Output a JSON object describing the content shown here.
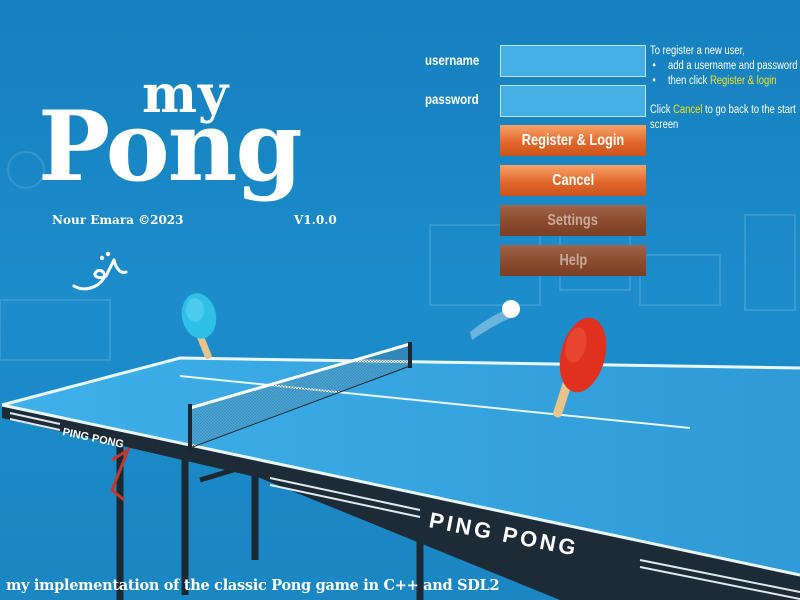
{
  "title": {
    "my": "my",
    "pong": "Pong"
  },
  "author": "Nour Emara ©2023",
  "version": "V1.0.0",
  "form": {
    "username_label": "username",
    "password_label": "password",
    "username_value": "",
    "password_value": ""
  },
  "buttons": {
    "register": "Register & Login",
    "cancel": "Cancel",
    "settings": "Settings",
    "help": "Help"
  },
  "help_text": {
    "intro": "To register a new user,",
    "step1": "add a username and password",
    "step2_prefix": "then click ",
    "step2_highlight": "Register & login",
    "cancel_prefix": "Click ",
    "cancel_highlight": "Cancel",
    "cancel_suffix": " to go back to the start",
    "cancel_suffix2": "screen"
  },
  "table_brand": {
    "side": "PING PONG",
    "front": "PING PONG"
  },
  "tagline": "my implementation of the classic Pong game in C++ and SDL2",
  "colors": {
    "background": "#1a86c2",
    "table": "#3aa7e1",
    "primary_button": "#e8702f",
    "dim_button": "#8a4a2e",
    "input": "#46b0e6",
    "highlight": "#f2e21c",
    "blue_paddle": "#2ec0e6",
    "red_paddle": "#e0301e"
  },
  "icons": {
    "signature": "arabic-calligraphy-signature",
    "blue_paddle": "blue-paddle-icon",
    "red_paddle": "red-paddle-icon",
    "ball": "ball-icon"
  }
}
